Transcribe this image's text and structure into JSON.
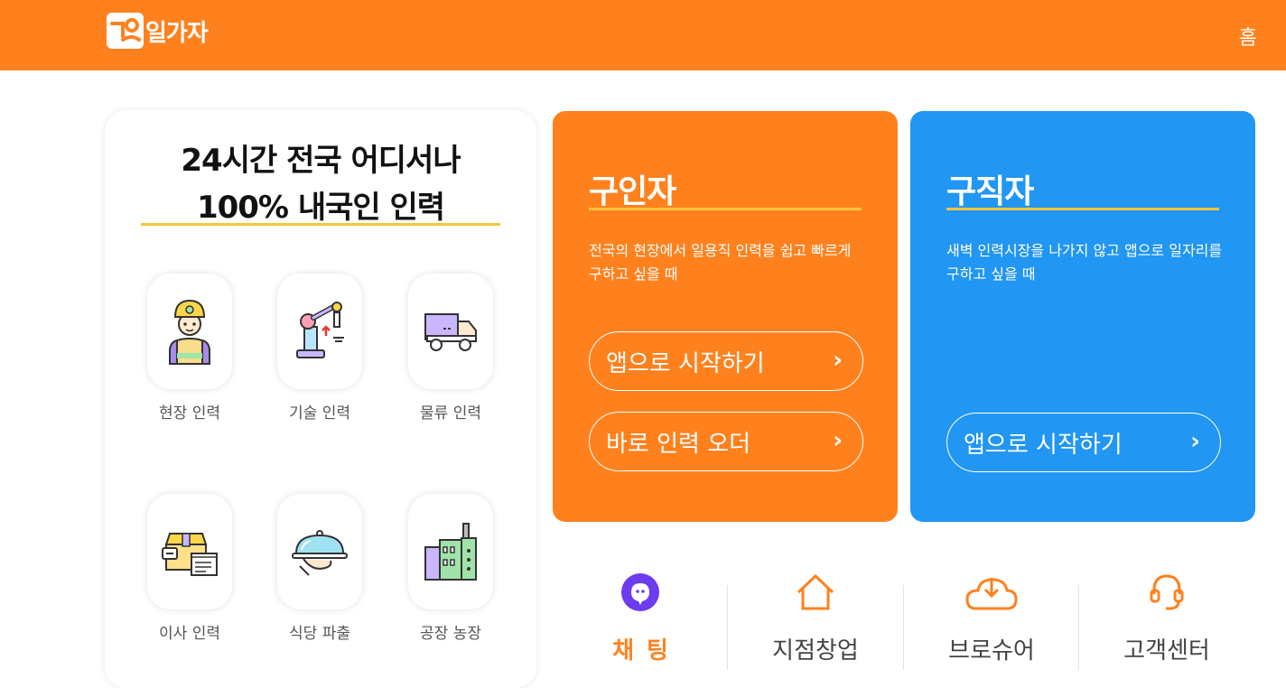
{
  "header": {
    "logo_text": "일가자",
    "home_link": "홈",
    "bg_color": "#ff811e"
  },
  "hero": {
    "line1": "24시간 전국 어디서나",
    "line2": "100% 내국인 인력"
  },
  "services": [
    {
      "label": "현장 인력",
      "icon": "construction-worker-icon"
    },
    {
      "label": "기술 인력",
      "icon": "robot-arm-icon"
    },
    {
      "label": "물류 인력",
      "icon": "delivery-truck-icon"
    },
    {
      "label": "이사 인력",
      "icon": "moving-box-icon"
    },
    {
      "label": "식당 파출",
      "icon": "serving-cloche-icon"
    },
    {
      "label": "공장 농장",
      "icon": "factory-icon"
    }
  ],
  "employer": {
    "title": "구인자",
    "desc": "전국의 현장에서 일용직 인력을 쉽고 빠르게 구하고 싶을 때",
    "btn_app": "앱으로 시작하기",
    "btn_order": "바로 인력 오더",
    "color": "#ff811e"
  },
  "jobseeker": {
    "title": "구직자",
    "desc": "새벽 인력시장을 나가지 않고 앱으로 일자리를 구하고 싶을 때",
    "btn_app": "앱으로 시작하기",
    "color": "#2196f3"
  },
  "bottom_nav": {
    "chat": "채팅",
    "franchise": "지점창업",
    "brochure": "브로슈어",
    "support": "고객센터"
  }
}
